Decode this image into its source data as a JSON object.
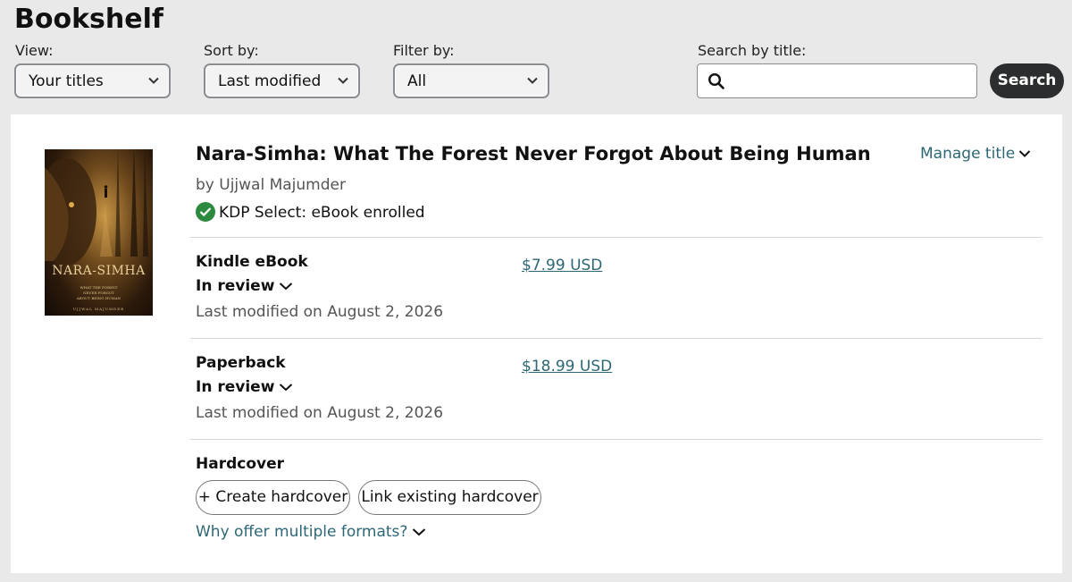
{
  "page": {
    "title": "Bookshelf"
  },
  "controls": {
    "view": {
      "label": "View:",
      "value": "Your titles"
    },
    "sort": {
      "label": "Sort by:",
      "value": "Last modified"
    },
    "filter": {
      "label": "Filter by:",
      "value": "All"
    },
    "search": {
      "label": "Search by title:",
      "placeholder": "",
      "button": "Search"
    }
  },
  "book": {
    "title": "Nara-Simha: What The Forest Never Forgot About Being Human",
    "author": "by Ujjwal Majumder",
    "kdp_status": "KDP Select: eBook enrolled",
    "manage_label": "Manage title",
    "cover": {
      "title": "NARA-SIMHA",
      "subtitle": "WHAT THE FOREST\nNEVER FORGOT\nABOUT BEING HUMAN",
      "author": "UJJWAL MAJUMDER"
    },
    "formats": [
      {
        "name": "Kindle eBook",
        "status": "In review",
        "modified": "Last modified on August 2, 2026",
        "price": "$7.99 USD"
      },
      {
        "name": "Paperback",
        "status": "In review",
        "modified": "Last modified on August 2, 2026",
        "price": "$18.99 USD"
      }
    ],
    "hardcover": {
      "name": "Hardcover",
      "create_label": "+ Create hardcover",
      "link_label": "Link existing hardcover",
      "why_label": "Why offer multiple formats?"
    }
  },
  "colors": {
    "link": "#2d6775",
    "check": "#2b8a3e",
    "search_button": "#2b2d2f"
  }
}
